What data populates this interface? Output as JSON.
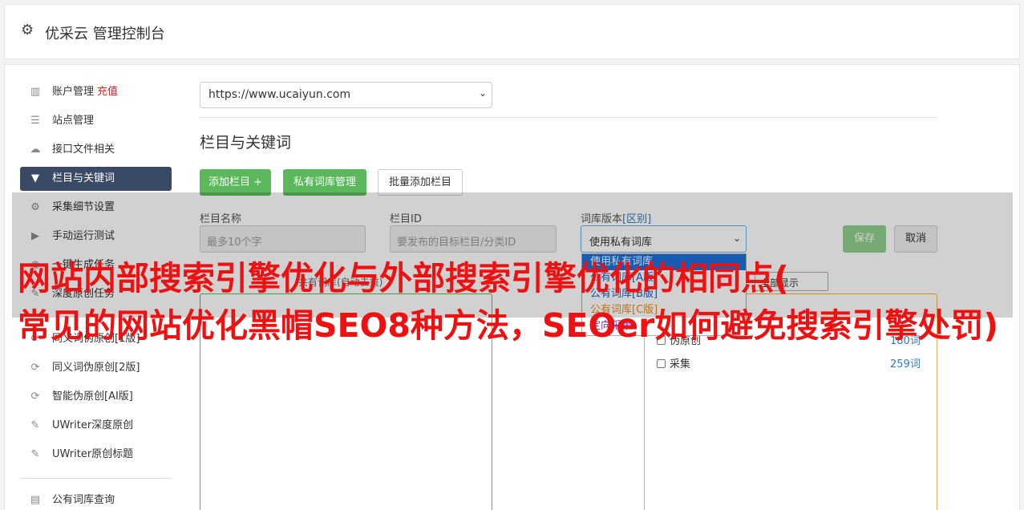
{
  "header": {
    "title": "优采云 管理控制台"
  },
  "sidebar": {
    "items": [
      {
        "label": "账户管理",
        "badge": "充值",
        "icon": "chart-icon"
      },
      {
        "label": "站点管理",
        "icon": "server-icon"
      },
      {
        "label": "接口文件相关",
        "icon": "cloud-upload-icon"
      },
      {
        "label": "栏目与关键词",
        "icon": "filter-icon",
        "active": true
      },
      {
        "label": "采集细节设置",
        "icon": "cogs-icon"
      },
      {
        "label": "手动运行测试",
        "icon": "play-icon"
      },
      {
        "label": "一键生成任务",
        "icon": "database-icon"
      },
      {
        "label": "深度原创任务",
        "icon": "edit-icon"
      },
      {
        "label": "同义词伪原创[1版]",
        "icon": "refresh-icon"
      },
      {
        "label": "同义词伪原创[2版]",
        "icon": "refresh-icon"
      },
      {
        "label": "智能伪原创[AI版]",
        "icon": "refresh-icon"
      },
      {
        "label": "UWriter深度原创",
        "icon": "edit-icon"
      },
      {
        "label": "UWriter原创标题",
        "icon": "edit-icon"
      },
      {
        "label": "公有词库查询",
        "icon": "book-icon"
      }
    ]
  },
  "main": {
    "site_select": "https://www.ucaiyun.com",
    "section_title": "栏目与关键词",
    "buttons": {
      "add_column": "添加栏目 +",
      "private_lib": "私有词库管理",
      "batch_add": "批量添加栏目"
    },
    "form": {
      "name_label": "栏目名称",
      "name_placeholder": "最多10个字",
      "id_label": "栏目ID",
      "id_placeholder": "要发布的目标栏目/分类ID",
      "lib_label": "词库版本",
      "lib_label_link": "[区别]",
      "lib_selected": "使用私有词库",
      "save": "保存",
      "cancel": "取消"
    },
    "dropdown_options": [
      "使用私有词库",
      "公有词库[A版]",
      "公有词库[B版]",
      "公有词库[C版]",
      "定向采集"
    ],
    "hint": "共有词库(自动去重)",
    "small_select": "全部显示",
    "options": [
      {
        "label": "伪原创",
        "count": "180词"
      },
      {
        "label": "采集",
        "count": "259词"
      }
    ]
  },
  "watermark": {
    "line1": "网站内部搜索引擎优化与外部搜索引擎优化的相同点(",
    "line2": "常见的网站优化黑帽SEO8种方法，SEOer如何避免搜索引擎处罚)"
  },
  "colors": {
    "accent_green": "#5cb85c",
    "nav_active": "#3a4a66",
    "watermark": "#ee1111",
    "orange_border": "#f0ad4e"
  }
}
